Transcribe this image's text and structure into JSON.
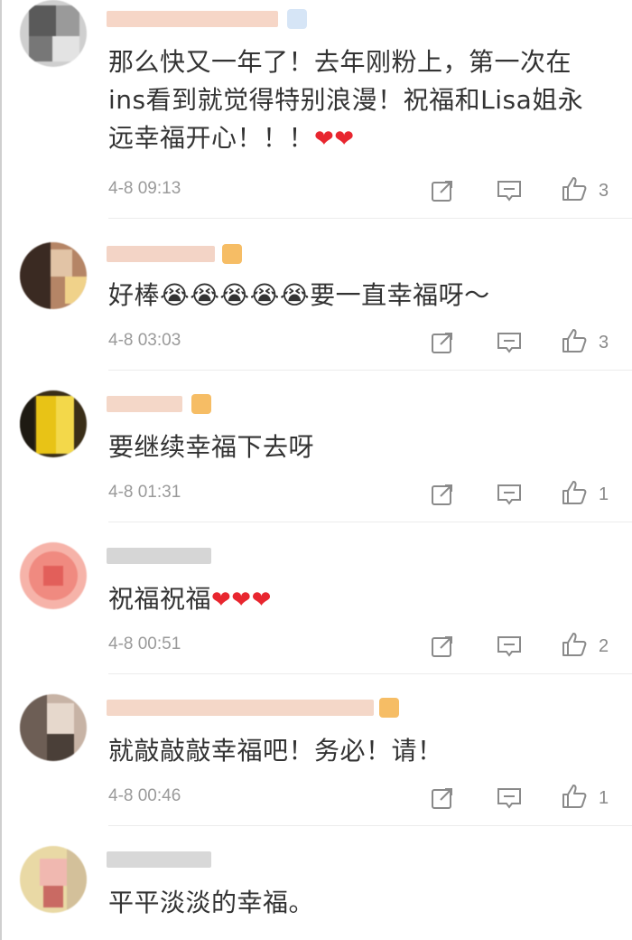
{
  "comments": [
    {
      "text": "那么快又一年了！去年刚粉上，第一次在ins看到就觉得特别浪漫！祝福和Lisa姐永远幸福开心！！！",
      "emoji_suffix": "❤❤",
      "time": "4-8 09:13",
      "likes": "3",
      "avatar_colors": [
        "#5a5a5a",
        "#9a9a9a",
        "#d0d0d0",
        "#777777"
      ],
      "name_colors": [
        "#f6d6c7",
        "#cfe0f5"
      ]
    },
    {
      "text": "好棒😭😭😭😭😭要一直幸福呀～",
      "emoji_suffix": "",
      "time": "4-8 03:03",
      "likes": "3",
      "avatar_colors": [
        "#3a2a22",
        "#b58566",
        "#e2c4a6",
        "#f0d28a"
      ],
      "name_colors": [
        "#f3d4c6",
        "#f5b24a"
      ]
    },
    {
      "text": "要继续幸福下去呀",
      "emoji_suffix": "",
      "time": "4-8 01:31",
      "likes": "1",
      "avatar_colors": [
        "#1e1a12",
        "#e8c316",
        "#f3d84a",
        "#3a2e18"
      ],
      "name_colors": [
        "#f4d7c8",
        "#f5b24a"
      ]
    },
    {
      "text": "祝福祝福",
      "emoji_suffix": "❤❤❤",
      "time": "4-8 00:51",
      "likes": "2",
      "avatar_colors": [
        "#f08a80",
        "#f6b3a9",
        "#e25f5a",
        "#f9cfc8"
      ],
      "name_colors": [
        "#d6d6d6",
        "#e8e8e8"
      ]
    },
    {
      "text": "就敲敲敲幸福吧！务必！请！",
      "emoji_suffix": "",
      "time": "4-8 00:46",
      "likes": "1",
      "avatar_colors": [
        "#6d5e55",
        "#c7b3a5",
        "#e6d8cc",
        "#4a3f38"
      ],
      "name_colors": [
        "#f4d7c8",
        "#f5b24a"
      ]
    },
    {
      "text": "平平淡淡的幸福。",
      "emoji_suffix": "",
      "time": "",
      "likes": "",
      "avatar_colors": [
        "#e9d9a5",
        "#f0b8b0",
        "#d3c09a",
        "#c96a63"
      ],
      "name_colors": [
        "#d8d8d8",
        "#e6e6e6"
      ]
    }
  ],
  "icons": {
    "share": "share-icon",
    "comment": "comment-icon",
    "like": "like-icon"
  }
}
